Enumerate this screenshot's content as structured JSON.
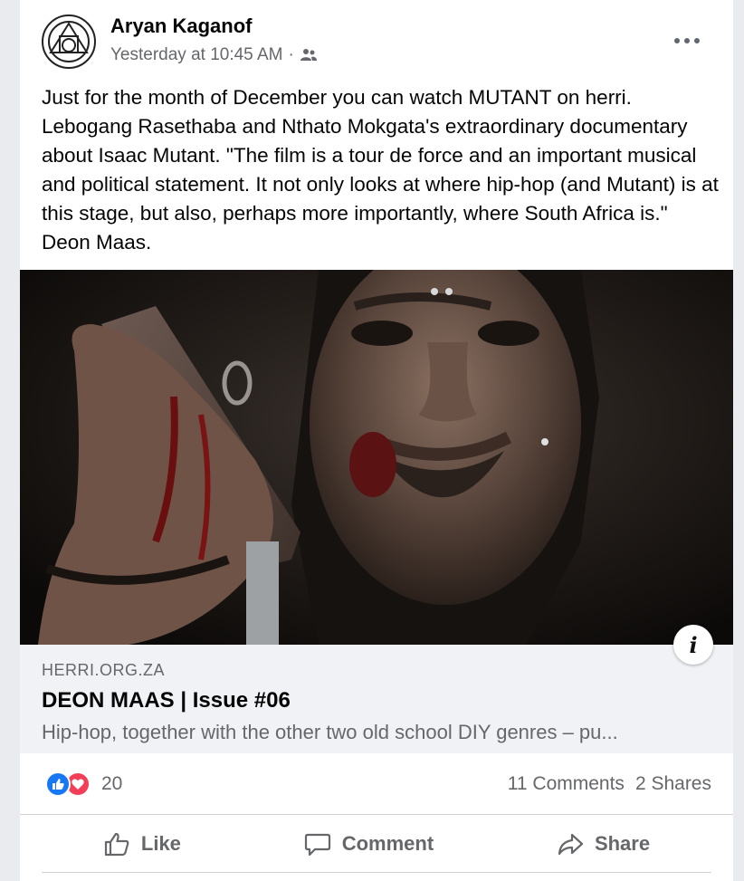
{
  "post": {
    "author": "Aryan Kaganof",
    "timestamp": "Yesterday at 10:45 AM",
    "separator": "·",
    "audience_icon": "friends-icon",
    "more_icon": "more-options-icon",
    "text": "Just for the month of December you can watch MUTANT on herri. Lebogang Rasethaba and Nthato Mokgata's extraordinary documentary about Isaac Mutant. \"The film is a tour de force and an important musical and political statement. It not only looks at where hip-hop (and Mutant) is at this stage, but also, perhaps more importantly, where South Africa is.\" Deon Maas."
  },
  "link_preview": {
    "domain": "HERRI.ORG.ZA",
    "title": "DEON MAAS | Issue #06",
    "description": "Hip-hop, together with the other two old school DIY genres – pu...",
    "info_glyph": "i"
  },
  "stats": {
    "reaction_count": "20",
    "comments": "11 Comments",
    "shares": "2 Shares"
  },
  "actions": {
    "like": "Like",
    "comment": "Comment",
    "share": "Share"
  },
  "colors": {
    "like_blue": "#1877f2",
    "love_red": "#f33e58",
    "secondary_text": "#65676b"
  }
}
